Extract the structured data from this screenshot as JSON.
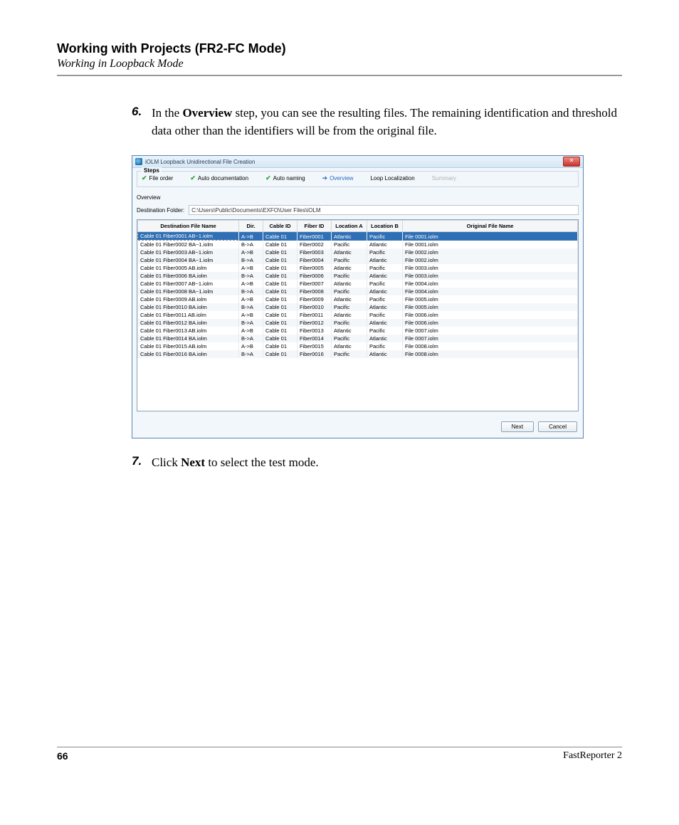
{
  "header": {
    "chapter": "Working with Projects (FR2-FC Mode)",
    "section": "Working in Loopback Mode"
  },
  "steps": {
    "s6": {
      "num": "6.",
      "prefix": "In the ",
      "bold1": "Overview",
      "rest": " step, you can see the resulting files. The remaining identification and threshold data other than the identifiers will be from the original file."
    },
    "s7": {
      "num": "7.",
      "prefix": "Click ",
      "bold1": "Next",
      "rest": " to select the test mode."
    }
  },
  "wizard": {
    "title": "iOLM Loopback Unidirectional File Creation",
    "steps_label": "Steps",
    "items": {
      "file_order": "File order",
      "auto_doc": "Auto documentation",
      "auto_naming": "Auto naming",
      "overview": "Overview",
      "loop_loc": "Loop Localization",
      "summary": "Summary"
    },
    "overview_label": "Overview",
    "dest_label": "Destination Folder:",
    "dest_value": "C:\\Users\\Public\\Documents\\EXFO\\User Files\\iOLM",
    "columns": {
      "dest": "Destination File Name",
      "dir": "Dir.",
      "cable": "Cable ID",
      "fiber": "Fiber ID",
      "loca": "Location A",
      "locb": "Location B",
      "orig": "Original File Name"
    },
    "rows": [
      {
        "dest": "Cable 01 Fiber0001 AB~1.iolm",
        "dir": "A->B",
        "cable": "Cable 01",
        "fiber": "Fiber0001",
        "la": "Atlantic",
        "lb": "Pacific",
        "orig": "File 0001.iolm",
        "sel": true
      },
      {
        "dest": "Cable 01 Fiber0002 BA~1.iolm",
        "dir": "B->A",
        "cable": "Cable 01",
        "fiber": "Fiber0002",
        "la": "Pacific",
        "lb": "Atlantic",
        "orig": "File 0001.iolm"
      },
      {
        "dest": "Cable 01 Fiber0003 AB~1.iolm",
        "dir": "A->B",
        "cable": "Cable 01",
        "fiber": "Fiber0003",
        "la": "Atlantic",
        "lb": "Pacific",
        "orig": "File 0002.iolm",
        "alt": true
      },
      {
        "dest": "Cable 01 Fiber0004 BA~1.iolm",
        "dir": "B->A",
        "cable": "Cable 01",
        "fiber": "Fiber0004",
        "la": "Pacific",
        "lb": "Atlantic",
        "orig": "File 0002.iolm",
        "alt": true
      },
      {
        "dest": "Cable 01 Fiber0005 AB.iolm",
        "dir": "A->B",
        "cable": "Cable 01",
        "fiber": "Fiber0005",
        "la": "Atlantic",
        "lb": "Pacific",
        "orig": "File 0003.iolm"
      },
      {
        "dest": "Cable 01 Fiber0006 BA.iolm",
        "dir": "B->A",
        "cable": "Cable 01",
        "fiber": "Fiber0006",
        "la": "Pacific",
        "lb": "Atlantic",
        "orig": "File 0003.iolm",
        "alt": true
      },
      {
        "dest": "Cable 01 Fiber0007 AB~1.iolm",
        "dir": "A->B",
        "cable": "Cable 01",
        "fiber": "Fiber0007",
        "la": "Atlantic",
        "lb": "Pacific",
        "orig": "File 0004.iolm"
      },
      {
        "dest": "Cable 01 Fiber0008 BA~1.iolm",
        "dir": "B->A",
        "cable": "Cable 01",
        "fiber": "Fiber0008",
        "la": "Pacific",
        "lb": "Atlantic",
        "orig": "File 0004.iolm",
        "alt": true
      },
      {
        "dest": "Cable 01 Fiber0009 AB.iolm",
        "dir": "A->B",
        "cable": "Cable 01",
        "fiber": "Fiber0009",
        "la": "Atlantic",
        "lb": "Pacific",
        "orig": "File 0005.iolm"
      },
      {
        "dest": "Cable 01 Fiber0010 BA.iolm",
        "dir": "B->A",
        "cable": "Cable 01",
        "fiber": "Fiber0010",
        "la": "Pacific",
        "lb": "Atlantic",
        "orig": "File 0005.iolm",
        "alt": true
      },
      {
        "dest": "Cable 01 Fiber0011 AB.iolm",
        "dir": "A->B",
        "cable": "Cable 01",
        "fiber": "Fiber0011",
        "la": "Atlantic",
        "lb": "Pacific",
        "orig": "File 0006.iolm"
      },
      {
        "dest": "Cable 01 Fiber0012 BA.iolm",
        "dir": "B->A",
        "cable": "Cable 01",
        "fiber": "Fiber0012",
        "la": "Pacific",
        "lb": "Atlantic",
        "orig": "File 0006.iolm",
        "alt": true
      },
      {
        "dest": "Cable 01 Fiber0013 AB.iolm",
        "dir": "A->B",
        "cable": "Cable 01",
        "fiber": "Fiber0013",
        "la": "Atlantic",
        "lb": "Pacific",
        "orig": "File 0007.iolm"
      },
      {
        "dest": "Cable 01 Fiber0014 BA.iolm",
        "dir": "B->A",
        "cable": "Cable 01",
        "fiber": "Fiber0014",
        "la": "Pacific",
        "lb": "Atlantic",
        "orig": "File 0007.iolm",
        "alt": true
      },
      {
        "dest": "Cable 01 Fiber0015 AB.iolm",
        "dir": "A->B",
        "cable": "Cable 01",
        "fiber": "Fiber0015",
        "la": "Atlantic",
        "lb": "Pacific",
        "orig": "File 0008.iolm"
      },
      {
        "dest": "Cable 01 Fiber0016 BA.iolm",
        "dir": "B->A",
        "cable": "Cable 01",
        "fiber": "Fiber0016",
        "la": "Pacific",
        "lb": "Atlantic",
        "orig": "File 0008.iolm",
        "alt": true
      }
    ],
    "buttons": {
      "next": "Next",
      "cancel": "Cancel"
    }
  },
  "footer": {
    "page": "66",
    "product": "FastReporter 2"
  }
}
